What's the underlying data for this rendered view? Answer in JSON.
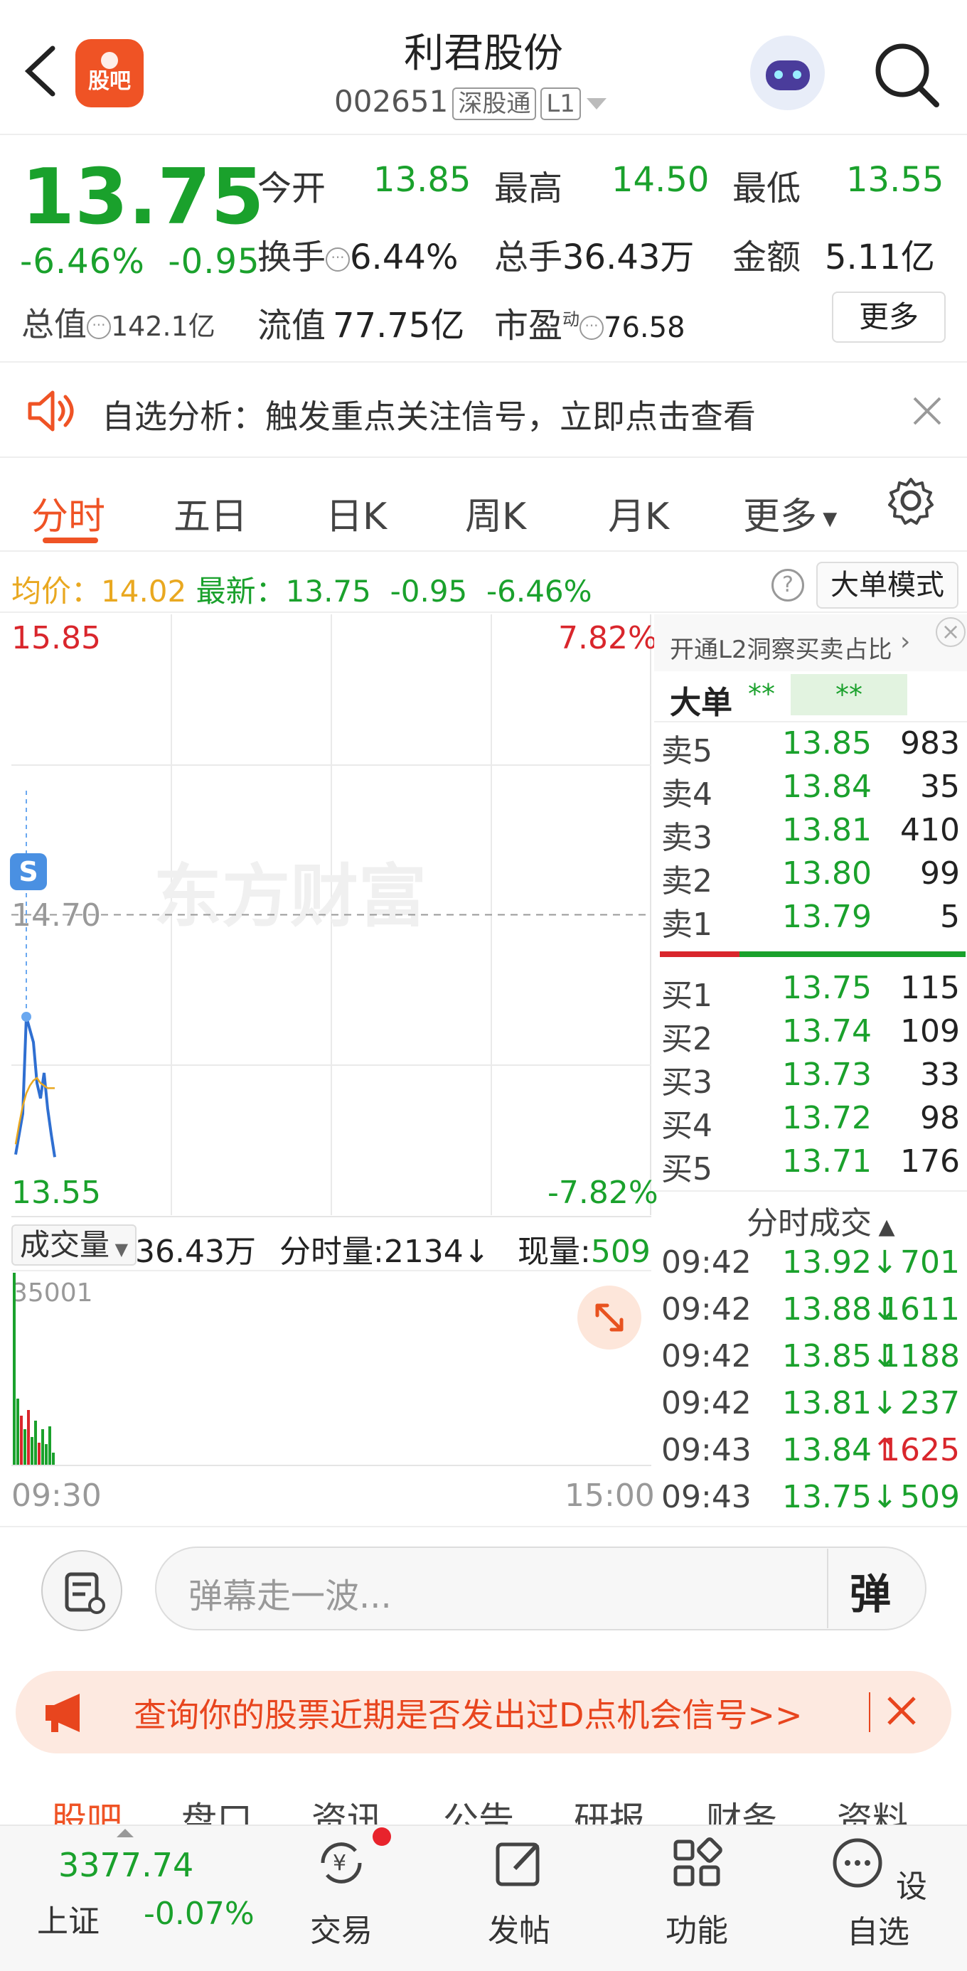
{
  "header": {
    "back_label": "返回",
    "guba_badge": "股吧",
    "stock_name": "利君股份",
    "stock_code": "002651",
    "tag_sgt": "深股通",
    "tag_level": "L1"
  },
  "quote": {
    "price": "13.75",
    "change_pct": "-6.46%",
    "change_abs": "-0.95",
    "total_value_label": "总值",
    "total_value": "142.1亿",
    "open_label": "今开",
    "open": "13.85",
    "high_label": "最高",
    "high": "14.50",
    "low_label": "最低",
    "low": "13.55",
    "turnover_label": "换手",
    "turnover": "6.44%",
    "volume_label": "总手",
    "volume": "36.43万",
    "amount_label": "金额",
    "amount": "5.11亿",
    "float_label": "流值",
    "float": "77.75亿",
    "pe_label": "市盈",
    "pe_sup": "动",
    "pe": "76.58",
    "more_label": "更多"
  },
  "banner": {
    "text": "自选分析：触发重点关注信号，立即点击查看"
  },
  "tabs": [
    {
      "label": "分时"
    },
    {
      "label": "五日"
    },
    {
      "label": "日K"
    },
    {
      "label": "周K"
    },
    {
      "label": "月K"
    },
    {
      "label": "更多"
    }
  ],
  "avg_row": {
    "avg_label": "均价：",
    "avg": "14.02",
    "latest_label": "最新：",
    "latest": "13.75",
    "chg": "-0.95",
    "pct": "-6.46%",
    "mode_label": "大单模式"
  },
  "chart": {
    "y_max": "15.85",
    "y_max_pct": "7.82%",
    "y_mid": "14.70",
    "y_min": "13.55",
    "y_min_pct": "-7.82%",
    "watermark": "东方财富",
    "marker_label": "S",
    "vol_selector": "成交量",
    "vol_total": "36.43万",
    "tick_vol": "分时量:2134",
    "cur_vol_label": "现量:",
    "cur_vol": "509",
    "vol_max": "35001",
    "time_start": "09:30",
    "time_end": "15:00"
  },
  "chart_data": {
    "type": "line",
    "title": "",
    "ylim": [
      13.55,
      15.85
    ],
    "reference": 14.7,
    "series": [
      {
        "values": [
          13.76,
          13.84,
          13.92,
          14.3,
          14.25,
          14.2,
          14.04,
          13.98,
          14.08,
          13.94,
          13.84,
          13.75
        ]
      },
      {
        "values": [
          13.8,
          13.88,
          13.95,
          14.0,
          14.03,
          14.05,
          14.06,
          14.04,
          14.03,
          14.02,
          14.02,
          14.02
        ]
      }
    ],
    "volume_series": {
      "ylim": [
        0,
        35001
      ],
      "bars": [
        {
          "value": 35001,
          "dir": "down"
        },
        {
          "value": 12000,
          "dir": "down"
        },
        {
          "value": 9000,
          "dir": "up"
        },
        {
          "value": 6500,
          "dir": "down"
        },
        {
          "value": 10000,
          "dir": "up"
        },
        {
          "value": 5000,
          "dir": "down"
        },
        {
          "value": 8000,
          "dir": "down"
        },
        {
          "value": 4000,
          "dir": "up"
        },
        {
          "value": 6500,
          "dir": "down"
        },
        {
          "value": 3800,
          "dir": "down"
        },
        {
          "value": 7000,
          "dir": "down"
        },
        {
          "value": 2200,
          "dir": "down"
        }
      ]
    }
  },
  "orderbook": {
    "l2_label": "开通L2洞察买卖占比",
    "big_label": "大单",
    "big_val": "**",
    "big_val2": "**",
    "asks": [
      {
        "label": "卖5",
        "price": "13.85",
        "qty": "983"
      },
      {
        "label": "卖4",
        "price": "13.84",
        "qty": "35"
      },
      {
        "label": "卖3",
        "price": "13.81",
        "qty": "410"
      },
      {
        "label": "卖2",
        "price": "13.80",
        "qty": "99"
      },
      {
        "label": "卖1",
        "price": "13.79",
        "qty": "5"
      }
    ],
    "bids": [
      {
        "label": "买1",
        "price": "13.75",
        "qty": "115"
      },
      {
        "label": "买2",
        "price": "13.74",
        "qty": "109"
      },
      {
        "label": "买3",
        "price": "13.73",
        "qty": "33"
      },
      {
        "label": "买4",
        "price": "13.72",
        "qty": "98"
      },
      {
        "label": "买5",
        "price": "13.71",
        "qty": "176"
      }
    ],
    "trades_label": "分时成交",
    "trades": [
      {
        "time": "09:42",
        "price": "13.92",
        "arrow": "↓",
        "qty": "701"
      },
      {
        "time": "09:42",
        "price": "13.88",
        "arrow": "↓",
        "qty": "1611"
      },
      {
        "time": "09:42",
        "price": "13.85",
        "arrow": "↓",
        "qty": "1188"
      },
      {
        "time": "09:42",
        "price": "13.81",
        "arrow": "↓",
        "qty": "237"
      },
      {
        "time": "09:43",
        "price": "13.84",
        "arrow": "↑",
        "qty": "1625"
      },
      {
        "time": "09:43",
        "price": "13.75",
        "arrow": "↓",
        "qty": "509"
      }
    ]
  },
  "comment": {
    "placeholder": "弹幕走一波...",
    "dan_label": "弹"
  },
  "dpoint": {
    "text": "查询你的股票近期是否发出过D点机会信号>>"
  },
  "subtabs": [
    {
      "label": "股吧"
    },
    {
      "label": "盘口"
    },
    {
      "label": "资讯"
    },
    {
      "label": "公告"
    },
    {
      "label": "研报"
    },
    {
      "label": "财务"
    },
    {
      "label": "资料"
    }
  ],
  "bottom_nav": {
    "index_value": "3377.74",
    "index_name": "上证",
    "index_pct": "-0.07%",
    "items": [
      {
        "label": "交易"
      },
      {
        "label": "发帖"
      },
      {
        "label": "功能"
      },
      {
        "label": "设自选"
      }
    ]
  },
  "colors": {
    "up": "#d9262c",
    "down": "#1aa12c",
    "accent": "#ef5325"
  }
}
